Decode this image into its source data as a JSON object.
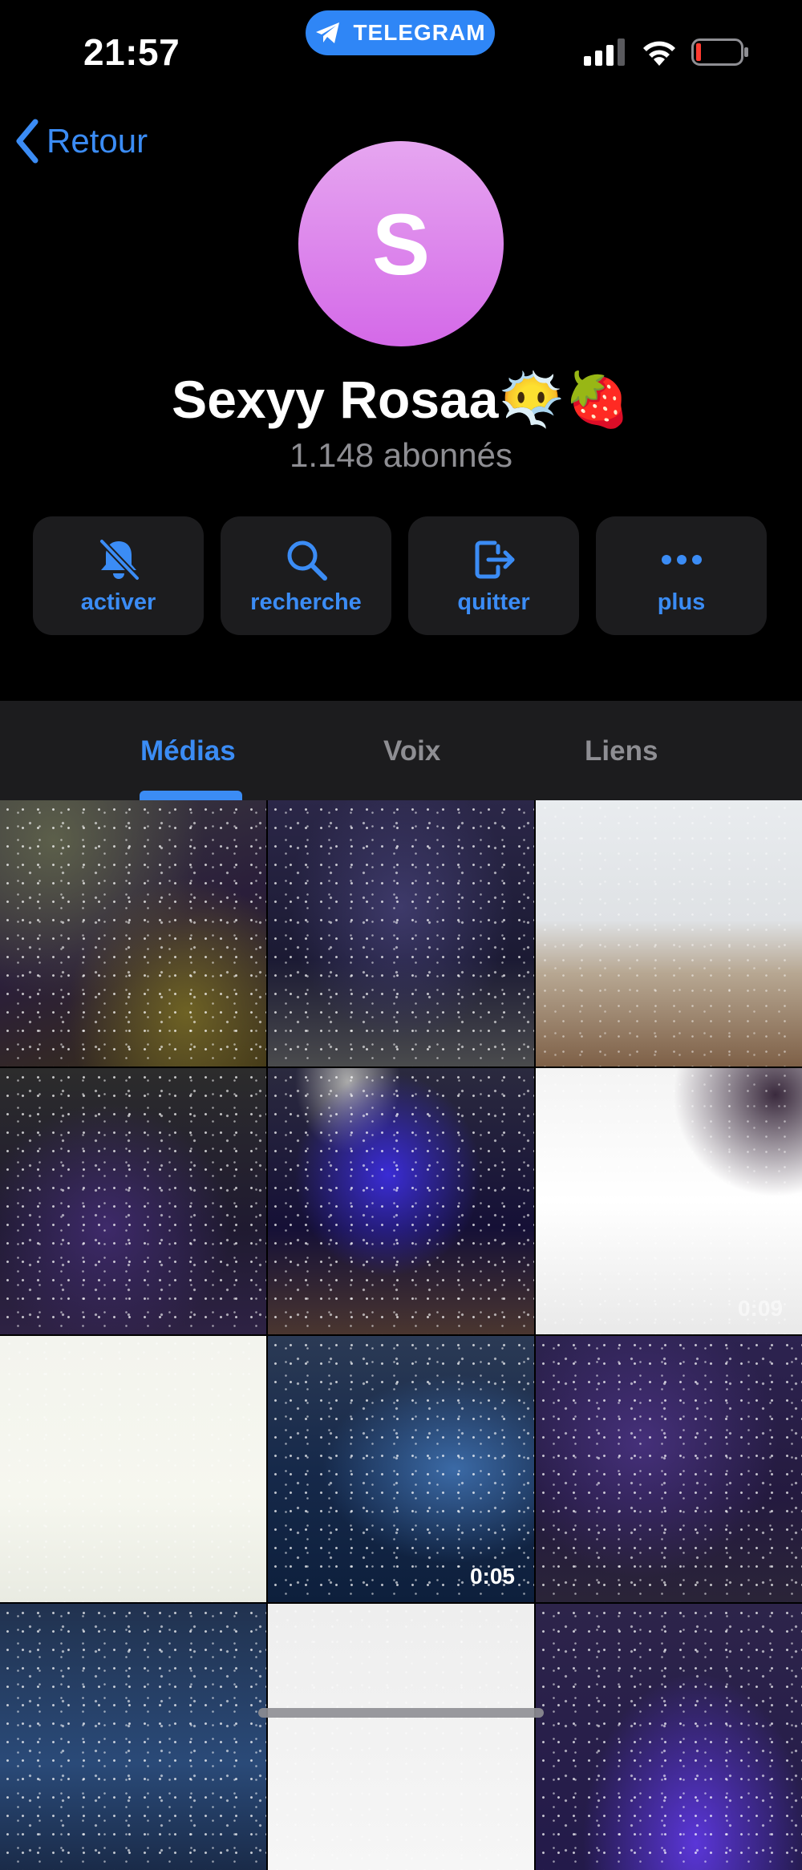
{
  "status_bar": {
    "time": "21:57",
    "pill_label": "TELEGRAM",
    "pill_icon": "telegram-plane-icon",
    "battery_color": "#ff3b30"
  },
  "nav": {
    "back_label": "Retour"
  },
  "channel": {
    "avatar_letter": "S",
    "name": "Sexyy Rosaa😶‍🌫️🍓",
    "subscribers": "1.148 abonnés"
  },
  "actions": [
    {
      "label": "activer",
      "icon": "bell-slash-icon"
    },
    {
      "label": "recherche",
      "icon": "search-icon"
    },
    {
      "label": "quitter",
      "icon": "leave-icon"
    },
    {
      "label": "plus",
      "icon": "more-icon"
    }
  ],
  "tabs": [
    {
      "label": "Médias",
      "active": true
    },
    {
      "label": "Voix",
      "active": false
    },
    {
      "label": "Liens",
      "active": false
    }
  ],
  "media": [
    {
      "duration": ""
    },
    {
      "duration": ""
    },
    {
      "duration": ""
    },
    {
      "duration": ""
    },
    {
      "duration": ""
    },
    {
      "duration": "0:09"
    },
    {
      "duration": ""
    },
    {
      "duration": "0:05"
    },
    {
      "duration": ""
    },
    {
      "duration": ""
    },
    {
      "duration": ""
    },
    {
      "duration": ""
    }
  ],
  "colors": {
    "accent": "#3b8cf5",
    "background": "#000000",
    "card": "#1c1c1e",
    "secondary_text": "#8e8e93"
  }
}
